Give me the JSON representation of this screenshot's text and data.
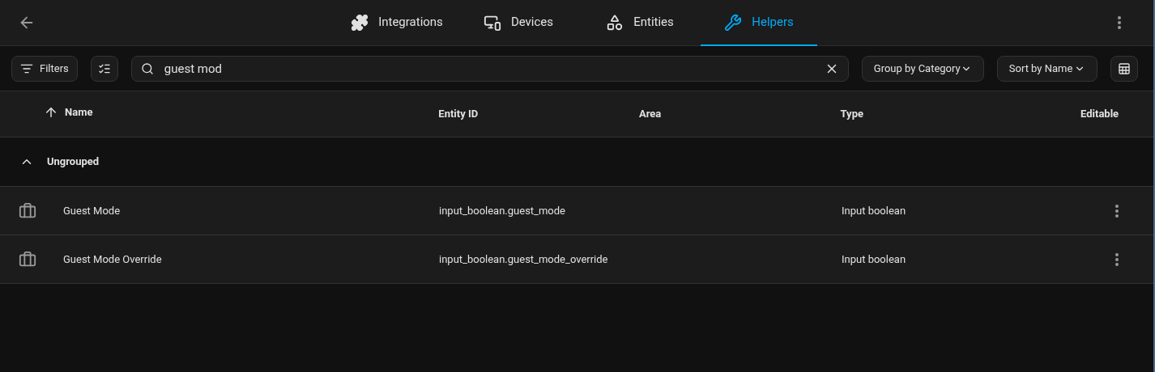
{
  "tabs": [
    {
      "label": "Integrations",
      "selected": false
    },
    {
      "label": "Devices",
      "selected": false
    },
    {
      "label": "Entities",
      "selected": false
    },
    {
      "label": "Helpers",
      "selected": true
    }
  ],
  "toolbar": {
    "filters_label": "Filters",
    "search_value": "guest mod",
    "group_by": "Group by Category",
    "sort_by": "Sort by Name"
  },
  "table": {
    "columns": [
      {
        "label": "Name",
        "sorted": true
      },
      {
        "label": "Entity ID",
        "sorted": false
      },
      {
        "label": "Area",
        "sorted": false
      },
      {
        "label": "Type",
        "sorted": false
      },
      {
        "label": "Editable",
        "sorted": false
      }
    ],
    "group": {
      "label": "Ungrouped",
      "expanded": true
    },
    "rows": [
      {
        "name": "Guest Mode",
        "entity_id": "input_boolean.guest_mode",
        "type": "Input boolean"
      },
      {
        "name": "Guest Mode Override",
        "entity_id": "input_boolean.guest_mode_override",
        "type": "Input boolean"
      }
    ]
  }
}
